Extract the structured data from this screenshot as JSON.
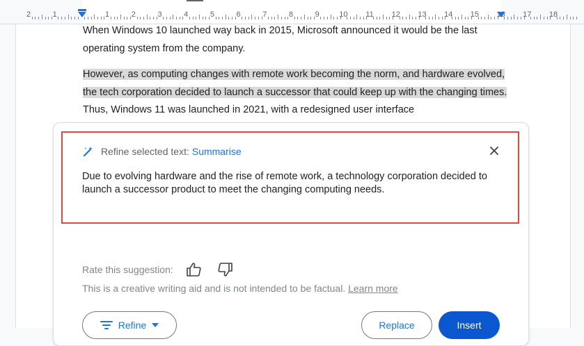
{
  "ruler": {
    "labels": [
      "2",
      "1",
      "",
      "1",
      "2",
      "3",
      "4",
      "5",
      "6",
      "7",
      "8",
      "9",
      "10",
      "11",
      "12",
      "13",
      "14",
      "15",
      "16",
      "17",
      "18"
    ]
  },
  "document": {
    "para1": "When Windows 10 launched way back in 2015, Microsoft announced it would be the last operating system from the company.",
    "para2_selected": "However, as computing changes with remote work becoming the norm, and hardware evolved, the tech corporation decided to launch a successor that could keep up with the changing times.",
    "para2_rest": " Thus, Windows 11 was launched in 2021, with a redesigned user interface"
  },
  "refine_panel": {
    "header_label": "Refine selected text:",
    "mode": "Summarise",
    "summary": "Due to evolving hardware and the rise of remote work, a technology corporation decided to launch a successor product to meet the changing computing needs.",
    "rate_label": "Rate this suggestion:",
    "disclaimer": "This is a creative writing aid and is not intended to be factual.",
    "learn_more": "Learn more",
    "refine_button": "Refine",
    "replace_button": "Replace",
    "insert_button": "Insert"
  },
  "colors": {
    "accent": "#1a73e8",
    "insert_button": "#0b57d0",
    "highlight_box": "#e2473f",
    "selection": "#d9d9d9"
  },
  "icons": [
    "pen-sparkle-icon",
    "close-icon",
    "thumbs-up-icon",
    "thumbs-down-icon",
    "sort-lines-icon",
    "caret-down-icon"
  ]
}
